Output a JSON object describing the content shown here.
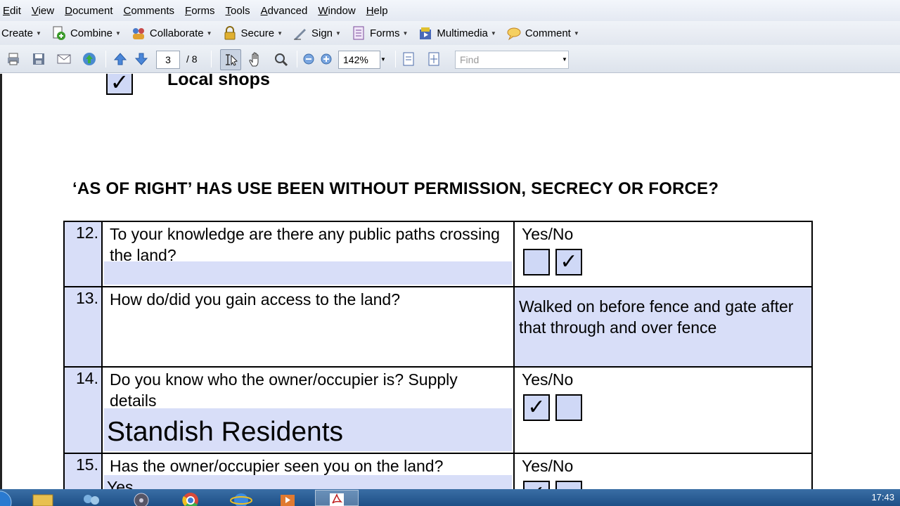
{
  "menu": [
    "Edit",
    "View",
    "Document",
    "Comments",
    "Forms",
    "Tools",
    "Advanced",
    "Window",
    "Help"
  ],
  "tasks": [
    {
      "label": "Create",
      "icon": "create-icon"
    },
    {
      "label": "Combine",
      "icon": "combine-icon"
    },
    {
      "label": "Collaborate",
      "icon": "collaborate-icon"
    },
    {
      "label": "Secure",
      "icon": "lock-icon"
    },
    {
      "label": "Sign",
      "icon": "pen-icon"
    },
    {
      "label": "Forms",
      "icon": "form-icon"
    },
    {
      "label": "Multimedia",
      "icon": "multimedia-icon"
    },
    {
      "label": "Comment",
      "icon": "comment-icon"
    }
  ],
  "nav": {
    "page_current": "3",
    "page_total": "/ 8",
    "zoom": "142%",
    "find_placeholder": "Find"
  },
  "document": {
    "top_option": {
      "label": "Local shops",
      "checked": true
    },
    "section_heading": "‘AS OF RIGHT’ HAS USE BEEN WITHOUT PERMISSION, SECRECY OR FORCE?",
    "rows": [
      {
        "num": "12.",
        "question": "To your knowledge are there any public paths crossing the land?",
        "answer_label": "Yes/No",
        "yes": false,
        "no": true
      },
      {
        "num": "13.",
        "question": "How do/did you gain access to the land?",
        "answer_text": "Walked on before fence and gate after that through and over fence"
      },
      {
        "num": "14.",
        "question": "Do you know who the owner/occupier is? Supply details",
        "details": "Standish Residents",
        "answer_label": "Yes/No",
        "yes": true,
        "no": false
      },
      {
        "num": "15.",
        "question": "Has the owner/occupier seen you on the land?",
        "details": "Yes",
        "answer_label": "Yes/No",
        "yes": true,
        "no": false
      }
    ]
  },
  "taskbar": {
    "clock": "17:43",
    "items": [
      "start-button",
      "explorer-icon",
      "people-icon",
      "chrome-icon",
      "ie-icon",
      "media-icon",
      "acrobat-icon"
    ]
  },
  "colors": {
    "field_fill": "#d8def8",
    "taskbar": "#2a5d95"
  }
}
